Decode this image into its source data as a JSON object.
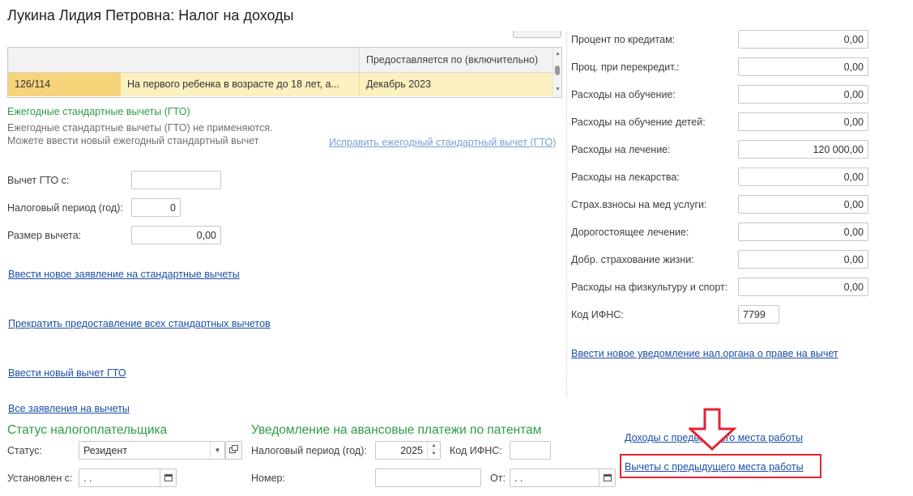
{
  "window": {
    "title": "Лукина Лидия Петровна: Налог на доходы"
  },
  "grid": {
    "header": {
      "col3": "Предоставляется по (включительно)"
    },
    "rows": [
      {
        "code": "126/114",
        "description": "На первого ребенка в возрасте до 18 лет, а...",
        "until": "Декабрь 2023"
      }
    ]
  },
  "gto": {
    "title": "Ежегодные стандартные вычеты (ГТО)",
    "note1": "Ежегодные стандартные вычеты (ГТО) не применяются.",
    "note2": "Можете ввести новый ежегодный стандартный вычет",
    "fix_link": "Исправить ежегодный стандартный вычет (ГТО)",
    "from_label": "Вычет ГТО с:",
    "from_value": "",
    "period_label": "Налоговый период (год):",
    "period_value": "0",
    "amount_label": "Размер вычета:",
    "amount_value": "0,00"
  },
  "links": {
    "new_standard": "Ввести новое заявление на стандартные вычеты",
    "stop_all": "Прекратить предоставление всех стандартных вычетов",
    "new_gto": "Ввести новый вычет ГТО",
    "all_applications": "Все заявления на вычеты",
    "new_notice": "Ввести новое уведомление нал.органа о праве на вычет",
    "prev_income": "Доходы с предыдущего места работы",
    "prev_deductions": "Вычеты с предыдущего места работы"
  },
  "right_fields": [
    {
      "label": "Процент по кредитам:",
      "value": "0,00"
    },
    {
      "label": "Проц. при перекредит.:",
      "value": "0,00"
    },
    {
      "label": "Расходы на обучение:",
      "value": "0,00"
    },
    {
      "label": "Расходы на обучение детей:",
      "value": "0,00"
    },
    {
      "label": "Расходы на лечение:",
      "value": "120 000,00"
    },
    {
      "label": "Расходы на лекарства:",
      "value": "0,00"
    },
    {
      "label": "Страх.взносы на мед услуги:",
      "value": "0,00"
    },
    {
      "label": "Дорогостоящее лечение:",
      "value": "0,00"
    },
    {
      "label": "Добр. страхование жизни:",
      "value": "0,00"
    },
    {
      "label": "Расходы на физкультуру и спорт:",
      "value": "0,00"
    }
  ],
  "ifns": {
    "label": "Код ИФНС:",
    "value": "7799"
  },
  "taxpayer": {
    "title": "Статус налогоплательщика",
    "status_label": "Статус:",
    "status_value": "Резидент",
    "since_label": "Установлен с:",
    "since_value": " .  ."
  },
  "patent": {
    "title": "Уведомление на авансовые платежи по патентам",
    "period_label": "Налоговый период (год):",
    "period_value": "2025",
    "ifns_label": "Код ИФНС:",
    "ifns_value": "",
    "number_label": "Номер:",
    "number_value": "",
    "from_label": "От:",
    "from_value": " .  ."
  },
  "colors": {
    "accent_green": "#2e9c47",
    "link_blue": "#1c4fa6",
    "selection": "#fbf0bf",
    "highlight_red": "#e52330"
  }
}
